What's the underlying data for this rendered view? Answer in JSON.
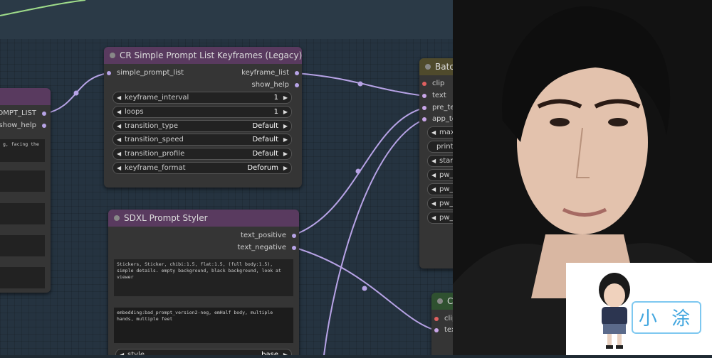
{
  "colors": {
    "canvas": "#253340",
    "node_body": "#353535",
    "header_purple": "#593a5f",
    "header_olive": "#4f4a2c",
    "header_green": "#2f5130",
    "link": "#b7a3e6"
  },
  "left_node": {
    "outputs": [
      "PROMPT_LIST",
      "show_help"
    ],
    "textbox": "g, facing the"
  },
  "keyframes_node": {
    "title": "CR Simple Prompt List Keyframes (Legacy)",
    "input": "simple_prompt_list",
    "outputs": [
      "keyframe_list",
      "show_help"
    ],
    "widgets": [
      {
        "label": "keyframe_interval",
        "value": "1"
      },
      {
        "label": "loops",
        "value": "1"
      },
      {
        "label": "transition_type",
        "value": "Default"
      },
      {
        "label": "transition_speed",
        "value": "Default"
      },
      {
        "label": "transition_profile",
        "value": "Default"
      },
      {
        "label": "keyframe_format",
        "value": "Deforum"
      }
    ]
  },
  "styler_node": {
    "title": "SDXL Prompt Styler",
    "outputs": [
      "text_positive",
      "text_negative"
    ],
    "positive_text": "Stickers, Sticker, chibi:1.5, flat:1.5, (full body:1.5), simple details. empty background, black background, look at viewer",
    "negative_text": "embedding:bad_prompt_version2-neg, emHalf body, multiple hands, multiple feet",
    "style_widget": {
      "label": "style",
      "value": "base"
    }
  },
  "batch_node": {
    "title": "Batc",
    "inputs": [
      "clip",
      "text",
      "pre_te",
      "app_te"
    ],
    "widgets": [
      "max",
      "print",
      "start",
      "pw_",
      "pw_",
      "pw_",
      "pw_"
    ]
  },
  "green_node": {
    "title": "C",
    "inputs": [
      "clip",
      "text"
    ]
  },
  "photo": {
    "icon": "portrait-photo",
    "badge_label": "小 涂"
  }
}
